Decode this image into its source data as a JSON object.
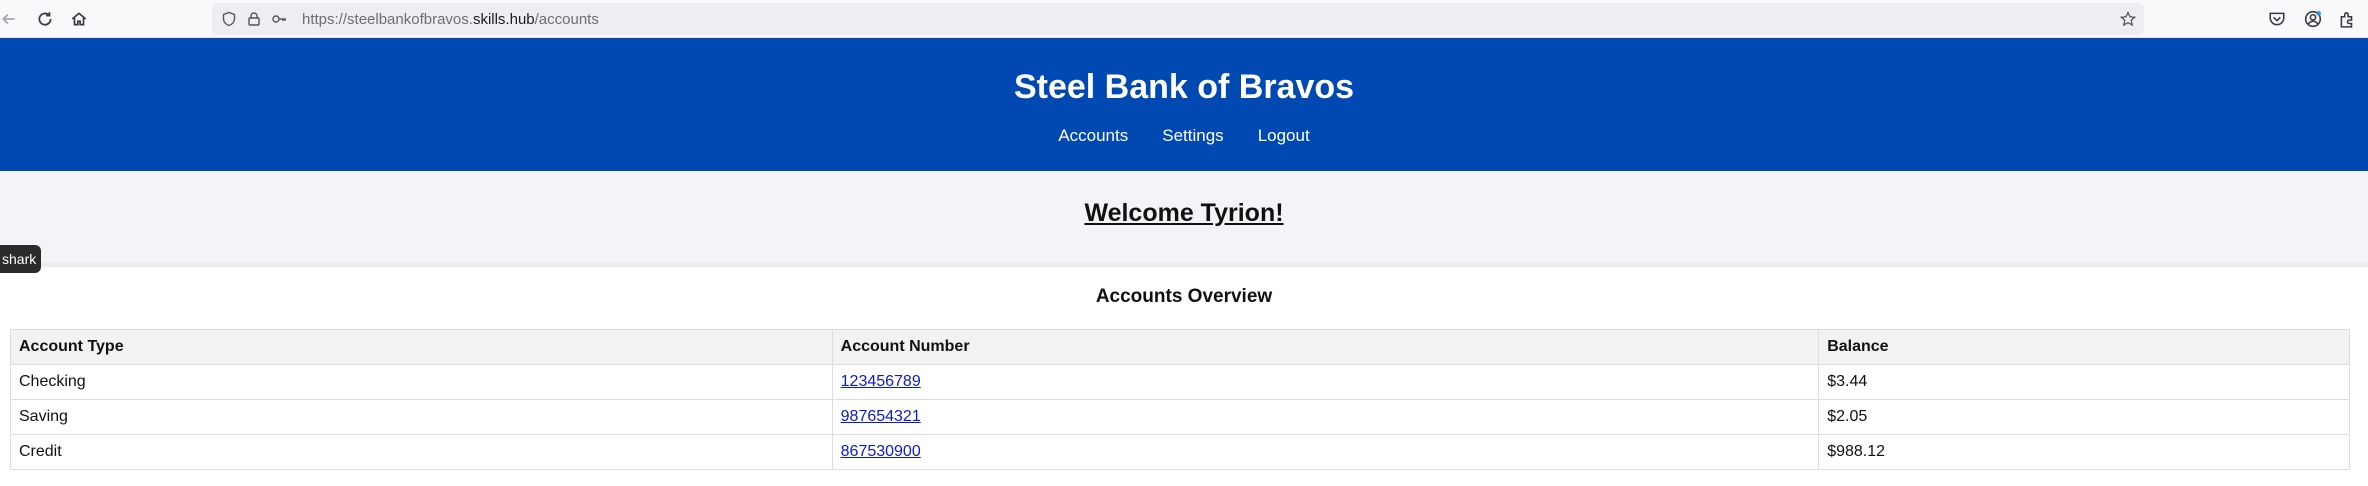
{
  "browser": {
    "url_prefix": "https://steelbankofbravos.",
    "url_host": "skills.hub",
    "url_path": "/accounts",
    "icons": [
      "back-arrow-icon",
      "reload-icon",
      "home-icon",
      "shield-icon",
      "lock-icon",
      "key-icon",
      "bookmark-star-icon",
      "pocket-icon",
      "account-icon",
      "extensions-icon"
    ]
  },
  "header": {
    "title": "Steel Bank of Bravos",
    "nav": [
      {
        "label": "Accounts"
      },
      {
        "label": "Settings"
      },
      {
        "label": "Logout"
      }
    ],
    "background_color": "#0048b2"
  },
  "welcome": {
    "text": "Welcome Tyrion!"
  },
  "tooltip": {
    "text": "shark"
  },
  "accounts": {
    "title": "Accounts Overview",
    "columns": [
      "Account Type",
      "Account Number",
      "Balance"
    ],
    "rows": [
      {
        "type": "Checking",
        "number": "123456789",
        "balance": "$3.44"
      },
      {
        "type": "Saving",
        "number": "987654321",
        "balance": "$2.05"
      },
      {
        "type": "Credit",
        "number": "867530900",
        "balance": "$988.12"
      }
    ]
  }
}
